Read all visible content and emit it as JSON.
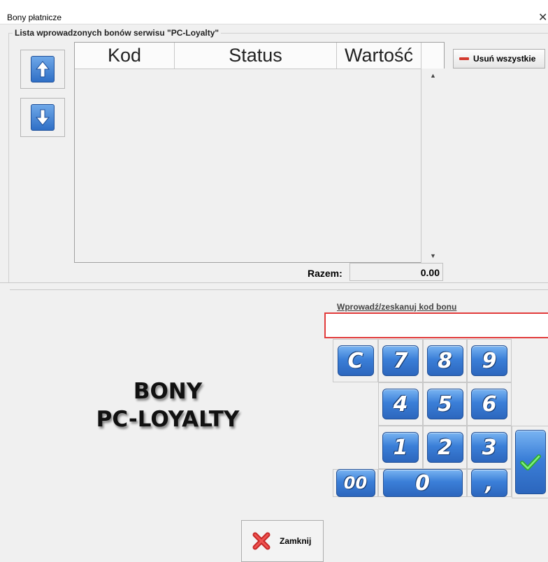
{
  "window": {
    "title": "Bony płatnicze",
    "close_glyph": "✕"
  },
  "list_group": {
    "label": "Lista wprowadzonych bonów serwisu \"PC-Loyalty\""
  },
  "table": {
    "columns": [
      "Kod",
      "Status",
      "Wartość"
    ],
    "rows": []
  },
  "buttons": {
    "move_up_icon": "arrow-up-icon",
    "move_down_icon": "arrow-down-icon",
    "clear_all_label": "Usuń wszystkie",
    "close_label": "Zamknij"
  },
  "summary": {
    "label": "Razem:",
    "value": "0.00"
  },
  "entry": {
    "label": "Wprowadź/zeskanuj kod bonu",
    "value": ""
  },
  "brand": {
    "line1": "BONY",
    "line2": "PC-LOYALTY"
  },
  "keypad": {
    "row1": [
      "C",
      "7",
      "8",
      "9"
    ],
    "row2": [
      "4",
      "5",
      "6"
    ],
    "row3": [
      "1",
      "2",
      "3"
    ],
    "row4": [
      "00",
      "0",
      ","
    ]
  },
  "colors": {
    "key_blue": "#3b7fd8",
    "input_highlight": "#e23b3b",
    "accept_green": "#3cc83c",
    "close_red": "#e03a3a"
  }
}
